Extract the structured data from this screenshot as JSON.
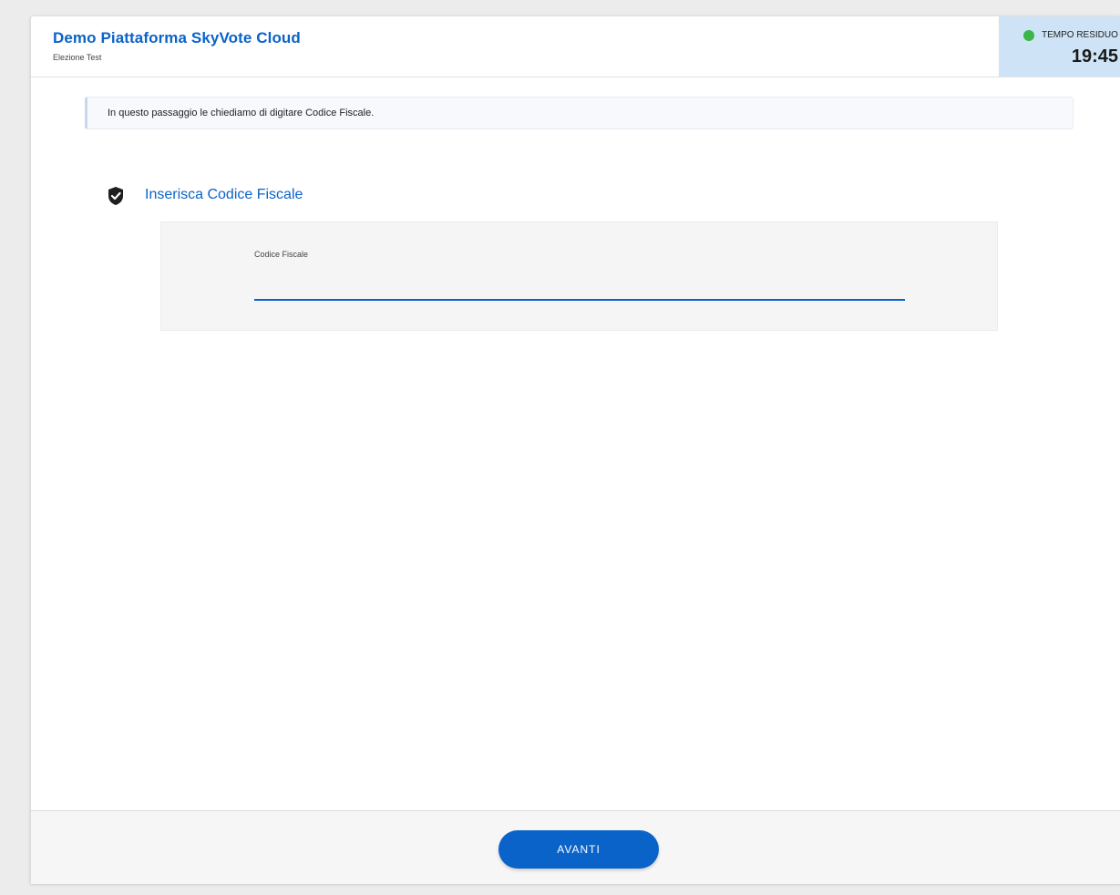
{
  "header": {
    "title": "Demo Piattaforma SkyVote Cloud",
    "subtitle": "Elezione Test"
  },
  "timer": {
    "label": "TEMPO RESIDUO",
    "value": "19:45",
    "status_color": "#3cb54a"
  },
  "info": {
    "message": "In questo passaggio le chiediamo di digitare Codice Fiscale."
  },
  "section": {
    "icon": "shield-check-icon",
    "title": "Inserisca Codice Fiscale"
  },
  "form": {
    "field_label": "Codice Fiscale",
    "field_value": "",
    "field_placeholder": ""
  },
  "footer": {
    "next_label": "AVANTI"
  },
  "colors": {
    "accent": "#0a63c9",
    "timer_background": "#cfe3f6"
  }
}
